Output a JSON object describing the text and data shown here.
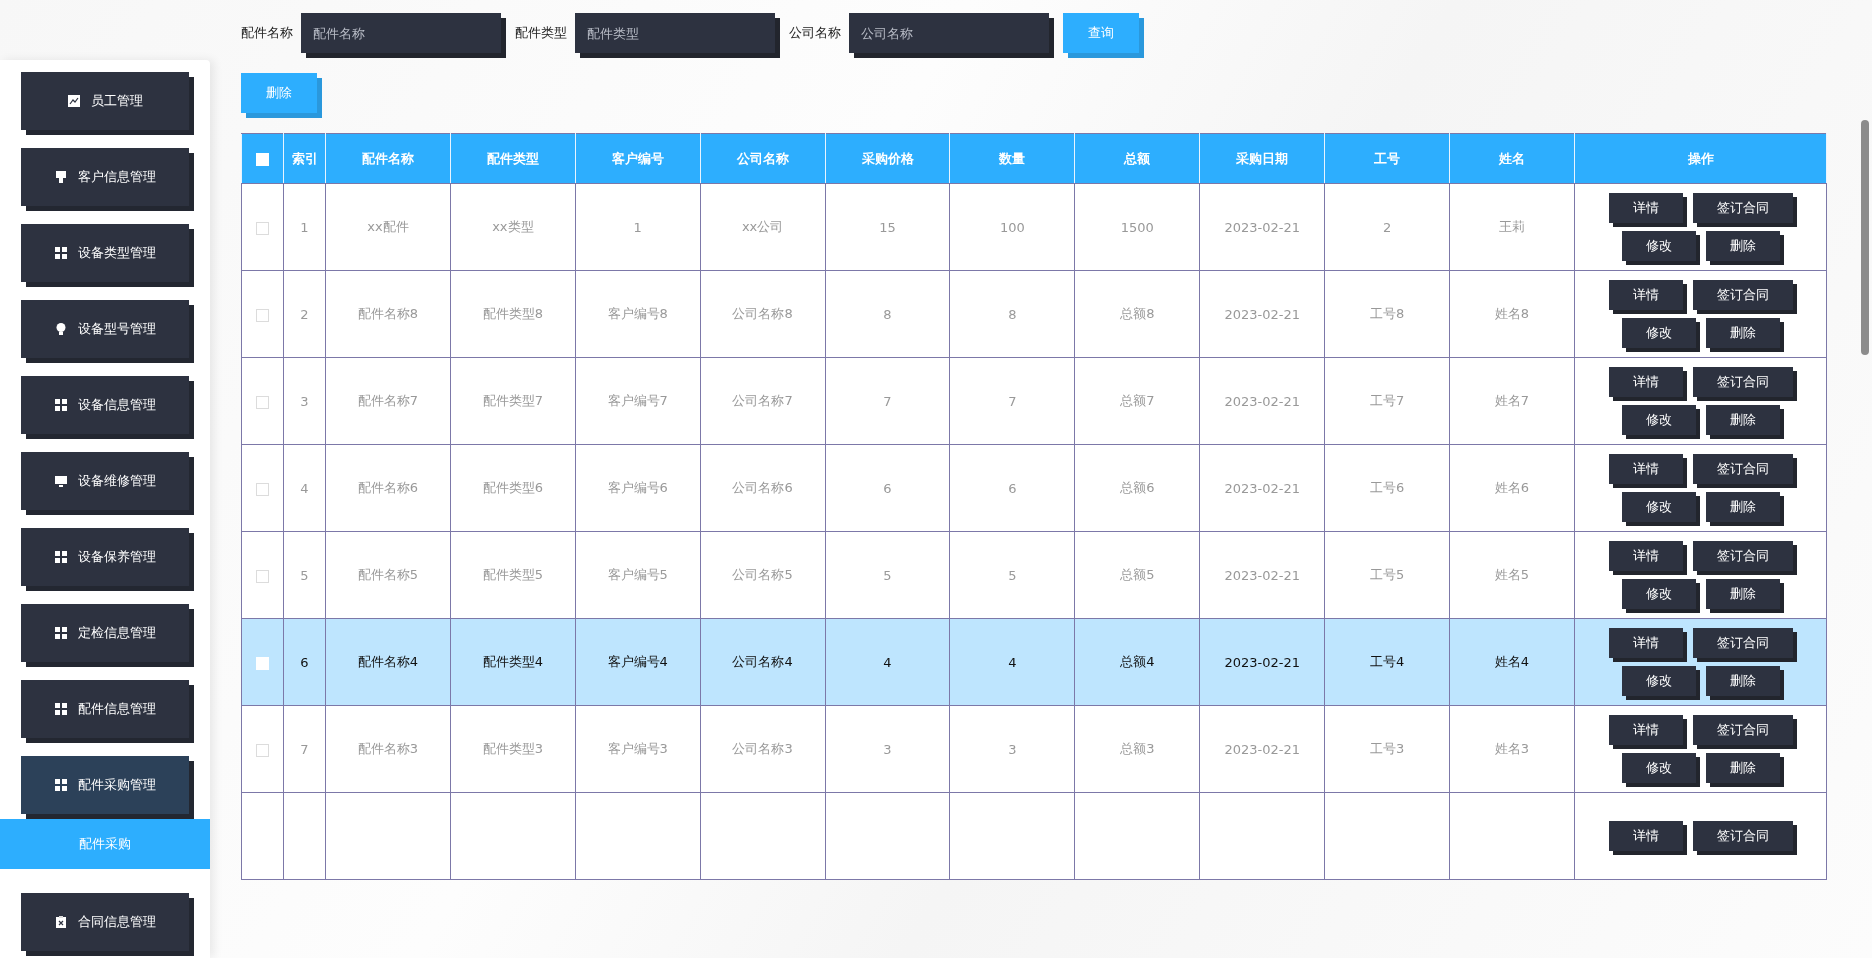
{
  "sidebar": {
    "items": [
      {
        "label": "员工管理",
        "expanded": false
      },
      {
        "label": "客户信息管理",
        "expanded": false
      },
      {
        "label": "设备类型管理",
        "expanded": false
      },
      {
        "label": "设备型号管理",
        "expanded": false
      },
      {
        "label": "设备信息管理",
        "expanded": false
      },
      {
        "label": "设备维修管理",
        "expanded": false
      },
      {
        "label": "设备保养管理",
        "expanded": false
      },
      {
        "label": "定检信息管理",
        "expanded": false
      },
      {
        "label": "配件信息管理",
        "expanded": false
      },
      {
        "label": "配件采购管理",
        "expanded": true,
        "children": [
          {
            "label": "配件采购",
            "selected": true
          }
        ]
      },
      {
        "label": "合同信息管理",
        "expanded": false
      }
    ]
  },
  "search": {
    "fields": [
      {
        "label": "配件名称",
        "placeholder": "配件名称"
      },
      {
        "label": "配件类型",
        "placeholder": "配件类型"
      },
      {
        "label": "公司名称",
        "placeholder": "公司名称"
      }
    ],
    "button": "查询"
  },
  "toolbar": {
    "delete_button": "删除"
  },
  "table": {
    "header_checkbox": {
      "checked": false
    },
    "columns": [
      "索引",
      "配件名称",
      "配件类型",
      "客户编号",
      "公司名称",
      "采购价格",
      "数量",
      "总额",
      "采购日期",
      "工号",
      "姓名",
      "操作"
    ],
    "rows": [
      {
        "selected": false,
        "checked": false,
        "cells": [
          "1",
          "xx配件",
          "xx类型",
          "1",
          "xx公司",
          "15",
          "100",
          "1500",
          "2023-02-21",
          "2",
          "王莉"
        ],
        "actions": [
          "详情",
          "签订合同",
          "修改",
          "删除"
        ]
      },
      {
        "selected": false,
        "checked": false,
        "cells": [
          "2",
          "配件名称8",
          "配件类型8",
          "客户编号8",
          "公司名称8",
          "8",
          "8",
          "总额8",
          "2023-02-21",
          "工号8",
          "姓名8"
        ],
        "actions": [
          "详情",
          "签订合同",
          "修改",
          "删除"
        ]
      },
      {
        "selected": false,
        "checked": false,
        "cells": [
          "3",
          "配件名称7",
          "配件类型7",
          "客户编号7",
          "公司名称7",
          "7",
          "7",
          "总额7",
          "2023-02-21",
          "工号7",
          "姓名7"
        ],
        "actions": [
          "详情",
          "签订合同",
          "修改",
          "删除"
        ]
      },
      {
        "selected": false,
        "checked": false,
        "cells": [
          "4",
          "配件名称6",
          "配件类型6",
          "客户编号6",
          "公司名称6",
          "6",
          "6",
          "总额6",
          "2023-02-21",
          "工号6",
          "姓名6"
        ],
        "actions": [
          "详情",
          "签订合同",
          "修改",
          "删除"
        ]
      },
      {
        "selected": false,
        "checked": false,
        "cells": [
          "5",
          "配件名称5",
          "配件类型5",
          "客户编号5",
          "公司名称5",
          "5",
          "5",
          "总额5",
          "2023-02-21",
          "工号5",
          "姓名5"
        ],
        "actions": [
          "详情",
          "签订合同",
          "修改",
          "删除"
        ]
      },
      {
        "selected": true,
        "checked": false,
        "cells": [
          "6",
          "配件名称4",
          "配件类型4",
          "客户编号4",
          "公司名称4",
          "4",
          "4",
          "总额4",
          "2023-02-21",
          "工号4",
          "姓名4"
        ],
        "actions": [
          "详情",
          "签订合同",
          "修改",
          "删除"
        ]
      },
      {
        "selected": false,
        "checked": false,
        "cells": [
          "7",
          "配件名称3",
          "配件类型3",
          "客户编号3",
          "公司名称3",
          "3",
          "3",
          "总额3",
          "2023-02-21",
          "工号3",
          "姓名3"
        ],
        "actions": [
          "详情",
          "签订合同",
          "修改",
          "删除"
        ]
      },
      {
        "selected": false,
        "cells": [],
        "actions": [
          "详情",
          "签订合同"
        ]
      }
    ]
  }
}
